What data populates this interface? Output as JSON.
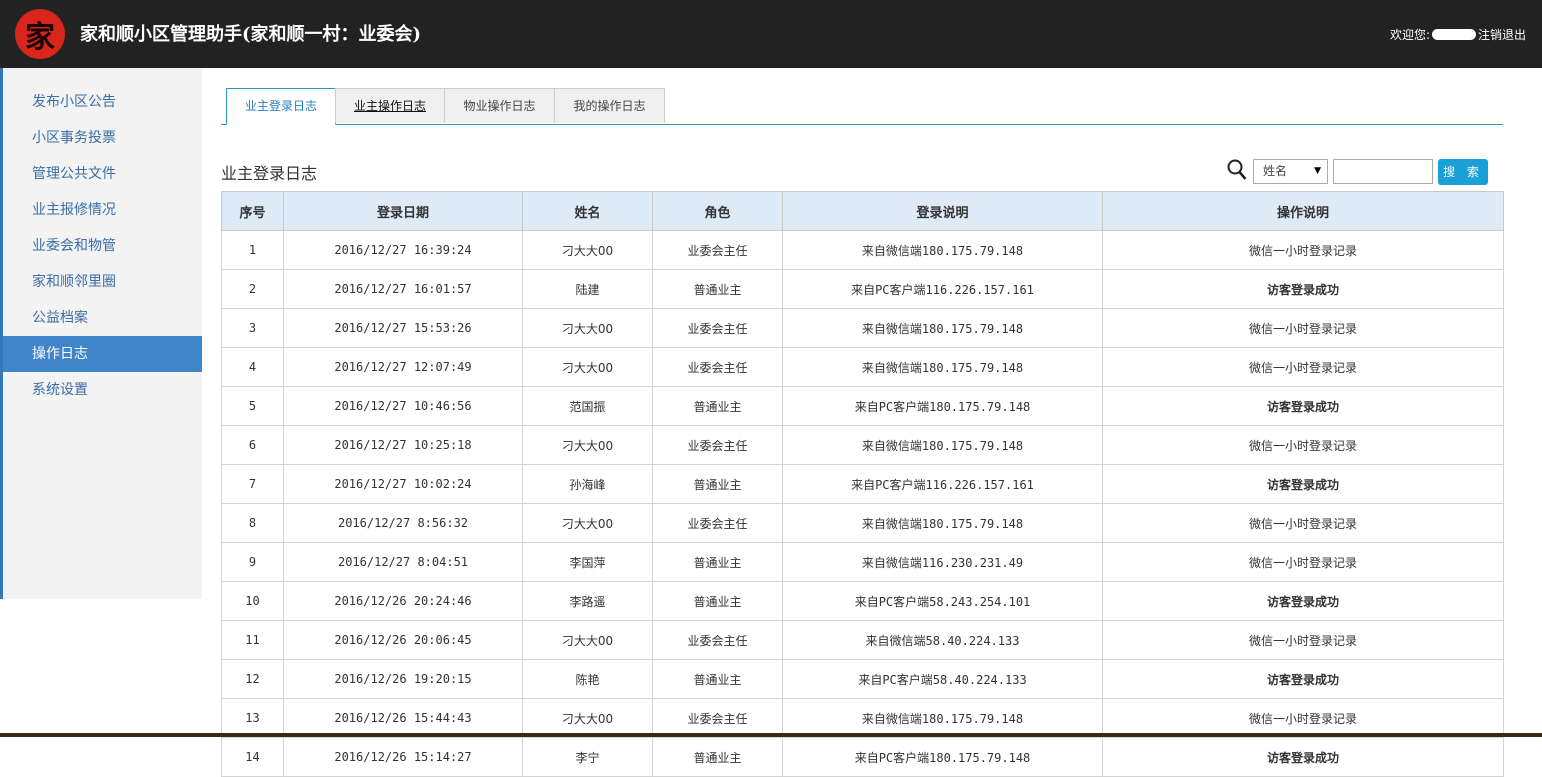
{
  "header": {
    "logo_char": "家",
    "title": "家和顺小区管理助手(家和顺一村：业委会)",
    "welcome": "欢迎您:",
    "logout": "注销退出"
  },
  "sidebar": {
    "items": [
      {
        "label": "发布小区公告"
      },
      {
        "label": "小区事务投票"
      },
      {
        "label": "管理公共文件"
      },
      {
        "label": "业主报修情况"
      },
      {
        "label": "业委会和物管"
      },
      {
        "label": "家和顺邻里圈"
      },
      {
        "label": "公益档案"
      },
      {
        "label": "操作日志",
        "active": true
      },
      {
        "label": "系统设置"
      }
    ]
  },
  "tabs": [
    {
      "label": "业主登录日志",
      "active": true
    },
    {
      "label": "业主操作日志"
    },
    {
      "label": "物业操作日志"
    },
    {
      "label": "我的操作日志"
    }
  ],
  "section_title": "业主登录日志",
  "search": {
    "select_value": "姓名",
    "input_value": "",
    "button_label": "搜 索"
  },
  "table": {
    "columns": [
      "序号",
      "登录日期",
      "姓名",
      "角色",
      "登录说明",
      "操作说明"
    ],
    "rows": [
      [
        "1",
        "2016/12/27 16:39:24",
        "刁大大00",
        "业委会主任",
        "来自微信端180.175.79.148",
        "微信一小时登录记录"
      ],
      [
        "2",
        "2016/12/27 16:01:57",
        "陆建",
        "普通业主",
        "来自PC客户端116.226.157.161",
        "访客登录成功"
      ],
      [
        "3",
        "2016/12/27 15:53:26",
        "刁大大00",
        "业委会主任",
        "来自微信端180.175.79.148",
        "微信一小时登录记录"
      ],
      [
        "4",
        "2016/12/27 12:07:49",
        "刁大大00",
        "业委会主任",
        "来自微信端180.175.79.148",
        "微信一小时登录记录"
      ],
      [
        "5",
        "2016/12/27 10:46:56",
        "范国振",
        "普通业主",
        "来自PC客户端180.175.79.148",
        "访客登录成功"
      ],
      [
        "6",
        "2016/12/27 10:25:18",
        "刁大大00",
        "业委会主任",
        "来自微信端180.175.79.148",
        "微信一小时登录记录"
      ],
      [
        "7",
        "2016/12/27 10:02:24",
        "孙海峰",
        "普通业主",
        "来自PC客户端116.226.157.161",
        "访客登录成功"
      ],
      [
        "8",
        "2016/12/27 8:56:32",
        "刁大大00",
        "业委会主任",
        "来自微信端180.175.79.148",
        "微信一小时登录记录"
      ],
      [
        "9",
        "2016/12/27 8:04:51",
        "李国萍",
        "普通业主",
        "来自微信端116.230.231.49",
        "微信一小时登录记录"
      ],
      [
        "10",
        "2016/12/26 20:24:46",
        "李路遥",
        "普通业主",
        "来自PC客户端58.243.254.101",
        "访客登录成功"
      ],
      [
        "11",
        "2016/12/26 20:06:45",
        "刁大大00",
        "业委会主任",
        "来自微信端58.40.224.133",
        "微信一小时登录记录"
      ],
      [
        "12",
        "2016/12/26 19:20:15",
        "陈艳",
        "普通业主",
        "来自PC客户端58.40.224.133",
        "访客登录成功"
      ],
      [
        "13",
        "2016/12/26 15:44:43",
        "刁大大00",
        "业委会主任",
        "来自微信端180.175.79.148",
        "微信一小时登录记录"
      ],
      [
        "14",
        "2016/12/26 15:14:27",
        "李宁",
        "普通业主",
        "来自PC客户端180.175.79.148",
        "访客登录成功"
      ]
    ]
  }
}
